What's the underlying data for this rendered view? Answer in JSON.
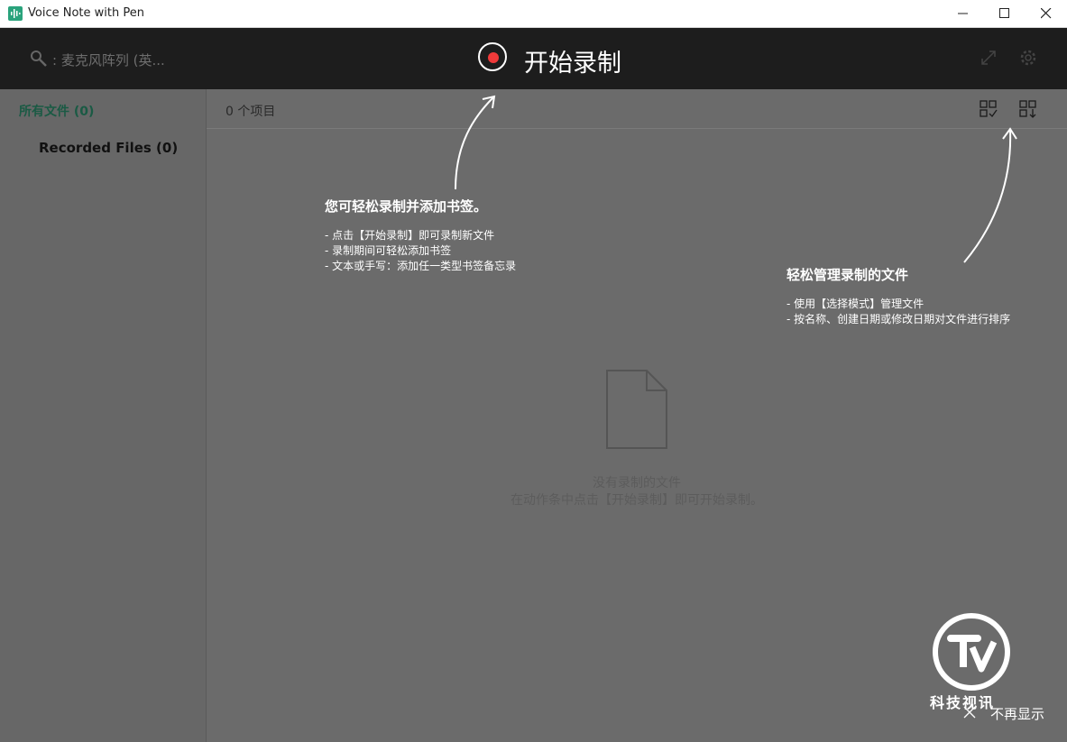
{
  "window": {
    "title": "Voice Note with Pen",
    "accent": "#2aa37c"
  },
  "header": {
    "mic_label": ": 麦克风阵列 (英...",
    "record_label": "开始录制",
    "record_color": "#f03a3a"
  },
  "sidebar": {
    "all_files": "所有文件 (0)",
    "recorded_files": "Recorded Files (0)"
  },
  "main": {
    "item_count": "0 个项目",
    "empty_line1": "没有录制的文件",
    "empty_line2": "在动作条中点击【开始录制】即可开始录制。"
  },
  "tips": {
    "record": {
      "title": "您可轻松录制并添加书签。",
      "lines": [
        "- 点击【开始录制】即可录制新文件",
        "- 录制期间可轻松添加书签",
        "- 文本或手写：添加任一类型书签备忘录"
      ]
    },
    "manage": {
      "title": "轻松管理录制的文件",
      "lines": [
        "- 使用【选择模式】管理文件",
        "- 按名称、创建日期或修改日期对文件进行排序"
      ]
    }
  },
  "footer": {
    "dismiss_label": "不再显示"
  },
  "watermark": {
    "text": "科技视讯"
  },
  "icons": [
    "app-icon",
    "minimize-icon",
    "maximize-icon",
    "close-icon",
    "search-icon",
    "record-icon",
    "expand-icon",
    "gear-icon",
    "select-mode-icon",
    "sort-icon",
    "empty-document-icon",
    "close-tips-icon"
  ]
}
